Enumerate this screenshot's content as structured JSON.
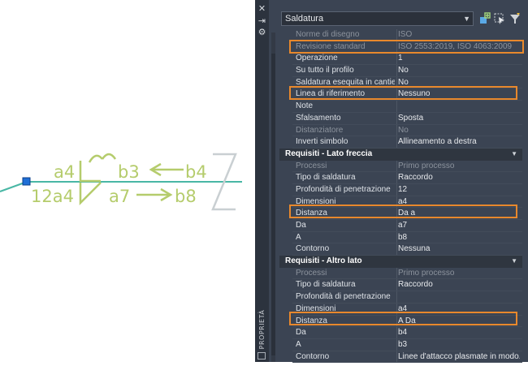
{
  "drawing": {
    "symbol_texts": {
      "a4_top": "a4",
      "b3": "b3",
      "b4": "b4",
      "a12_bottom": "12a4",
      "a7": "a7",
      "b8": "b8"
    }
  },
  "palette": {
    "vertical_label": "PROPRIETÀ",
    "strip_icons": [
      "close-icon",
      "auto-hide-icon",
      "settings-icon"
    ],
    "object_type": "Saldatura",
    "rows": [
      {
        "label": "Norme di disegno",
        "value": "ISO",
        "disabled": true
      },
      {
        "label": "Revisione standard",
        "value": "ISO 2553:2019, ISO 4063:2009",
        "disabled": true
      },
      {
        "label": "Operazione",
        "value": "1",
        "disabled": false
      },
      {
        "label": "Su tutto il profilo",
        "value": "No",
        "disabled": false
      },
      {
        "label": "Saldatura esequita in cantiere",
        "value": "No",
        "disabled": false
      },
      {
        "label": "Linea di riferimento",
        "value": "Nessuno",
        "disabled": false
      },
      {
        "label": "Note",
        "value": "",
        "disabled": false
      },
      {
        "label": "Sfalsamento",
        "value": "Sposta",
        "disabled": false
      },
      {
        "label": "Distanziatore",
        "value": "No",
        "disabled": true
      },
      {
        "label": "Inverti simbolo",
        "value": "Allineamento a destra",
        "disabled": false
      }
    ],
    "section1": {
      "title": "Requisiti - Lato freccia",
      "rows": [
        {
          "label": "Processi",
          "value": "Primo processo",
          "disabled": true
        },
        {
          "label": "Tipo di saldatura",
          "value": "Raccordo",
          "disabled": false
        },
        {
          "label": "Profondità di penetrazione",
          "value": "12",
          "disabled": false
        },
        {
          "label": "Dimensioni",
          "value": "a4",
          "disabled": false
        },
        {
          "label": "Distanza",
          "value": "Da a",
          "disabled": false
        },
        {
          "label": "Da",
          "value": "a7",
          "disabled": false
        },
        {
          "label": "A",
          "value": "b8",
          "disabled": false
        },
        {
          "label": "Contorno",
          "value": "Nessuna",
          "disabled": false
        }
      ]
    },
    "section2": {
      "title": "Requisiti - Altro lato",
      "rows": [
        {
          "label": "Processi",
          "value": "Primo processo",
          "disabled": true
        },
        {
          "label": "Tipo di saldatura",
          "value": "Raccordo",
          "disabled": false
        },
        {
          "label": "Profondità di penetrazione",
          "value": "",
          "disabled": false
        },
        {
          "label": "Dimensioni",
          "value": "a4",
          "disabled": false
        },
        {
          "label": "Distanza",
          "value": "A Da",
          "disabled": false
        },
        {
          "label": "Da",
          "value": "b4",
          "disabled": false
        },
        {
          "label": "A",
          "value": "b3",
          "disabled": false
        },
        {
          "label": "Contorno",
          "value": "Linee d'attacco plasmate in modo...",
          "disabled": false
        }
      ]
    },
    "colors": {
      "highlight": "#e8882c",
      "symbol": "#b5cc6c",
      "reference_line": "#49b7a5",
      "grip": "#1f6fd6"
    }
  }
}
